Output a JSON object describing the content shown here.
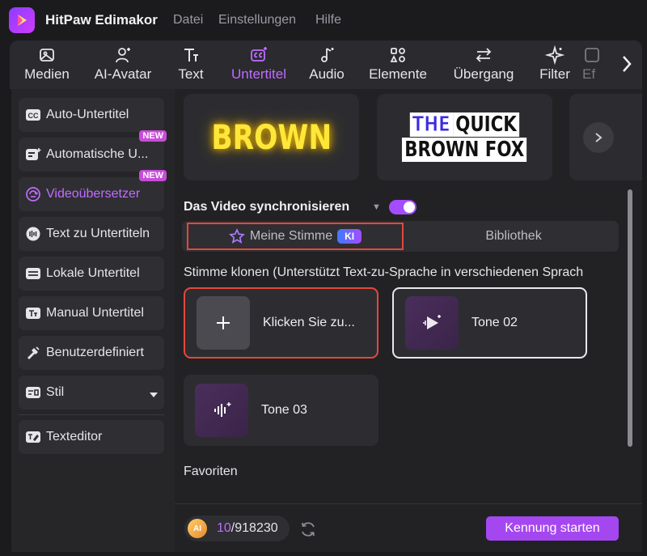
{
  "app": {
    "title": "HitPaw Edimakor"
  },
  "menu": {
    "file": "Datei",
    "settings": "Einstellungen",
    "help": "Hilfe"
  },
  "toolbar": {
    "items": [
      {
        "label": "Medien",
        "icon": "media-icon"
      },
      {
        "label": "AI-Avatar",
        "icon": "avatar-icon"
      },
      {
        "label": "Text",
        "icon": "text-icon"
      },
      {
        "label": "Untertitel",
        "icon": "subtitle-icon",
        "active": true
      },
      {
        "label": "Audio",
        "icon": "music-icon"
      },
      {
        "label": "Elemente",
        "icon": "elements-icon"
      },
      {
        "label": "Übergang",
        "icon": "transition-icon"
      },
      {
        "label": "Filter",
        "icon": "filter-icon"
      },
      {
        "label": "Ef",
        "icon": "effects-icon"
      }
    ]
  },
  "sidebar": {
    "items": [
      {
        "label": "Auto-Untertitel",
        "icon": "cc-icon"
      },
      {
        "label": "Automatische U...",
        "icon": "auto-subtitle-icon",
        "badge": "NEW"
      },
      {
        "label": "Videoübersetzer",
        "icon": "translate-icon",
        "badge": "NEW",
        "active": true
      },
      {
        "label": "Text zu Untertiteln",
        "icon": "text-to-subtitle-icon"
      },
      {
        "label": "Lokale Untertitel",
        "icon": "local-subtitle-icon"
      },
      {
        "label": "Manual Untertitel",
        "icon": "manual-subtitle-icon"
      },
      {
        "label": "Benutzerdefiniert",
        "icon": "custom-icon"
      },
      {
        "label": "Stil",
        "icon": "style-icon"
      },
      {
        "label": "Texteditor",
        "icon": "text-editor-icon"
      }
    ]
  },
  "styles": {
    "card1": "BROWN",
    "card2_line1a": "THE",
    "card2_line1b": "QUICK",
    "card2_line2": "BROWN FOX"
  },
  "sync": {
    "label": "Das Video synchronisieren",
    "enabled": true
  },
  "tabs": {
    "mine": "Meine Stimme",
    "mine_badge": "KI",
    "library": "Bibliothek"
  },
  "clone": {
    "label": "Stimme klonen (Unterstützt Text-zu-Sprache in verschiedenen Sprach"
  },
  "voices": {
    "add": "Klicken Sie zu...",
    "tone2": "Tone 02",
    "tone3": "Tone 03"
  },
  "favorites": {
    "label": "Favoriten"
  },
  "footer": {
    "coin": "AI",
    "credits_used": "10",
    "credits_total": "/918230",
    "start_button": "Kennung starten"
  },
  "colors": {
    "accent": "#a547f0",
    "highlight": "#e5483d",
    "active_text": "#c06cff"
  }
}
